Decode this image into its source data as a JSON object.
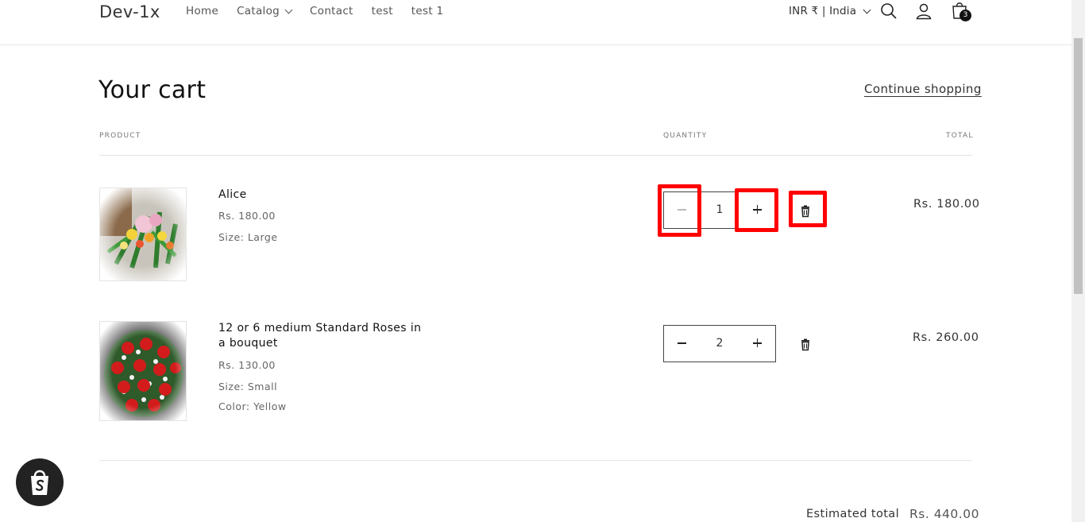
{
  "header": {
    "logo": "Dev-1x",
    "nav": [
      {
        "label": "Home"
      },
      {
        "label": "Catalog"
      },
      {
        "label": "Contact"
      },
      {
        "label": "test"
      },
      {
        "label": "test 1"
      }
    ],
    "locale": "INR ₹ | India",
    "cart_count": "3",
    "icons": [
      "search-icon",
      "account-icon",
      "cart-icon",
      "chevron-down-icon"
    ]
  },
  "cart": {
    "title": "Your cart",
    "continue_label": "Continue shopping",
    "columns": {
      "product": "PRODUCT",
      "quantity": "QUANTITY",
      "total": "TOTAL"
    },
    "items": [
      {
        "name": "Alice",
        "price": "Rs. 180.00",
        "options": [
          "Size: Large"
        ],
        "quantity": "1",
        "line_total": "Rs. 180.00",
        "image": "bouquet of lilies and mixed flowers"
      },
      {
        "name": "12 or 6 medium Standard Roses in a bouquet",
        "price": "Rs. 130.00",
        "options": [
          "Size: Small",
          "Color: Yellow"
        ],
        "quantity": "2",
        "line_total": "Rs. 260.00",
        "image": "bouquet of red roses"
      }
    ],
    "estimated_total_label": "Estimated total",
    "estimated_total": "Rs. 440.00"
  },
  "colors": {
    "highlight": "#ff0000",
    "text": "#121212",
    "muted": "#666666"
  }
}
